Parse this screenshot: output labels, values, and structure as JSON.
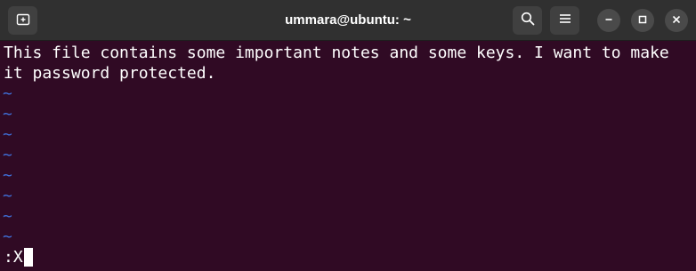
{
  "window": {
    "title": "ummara@ubuntu: ~"
  },
  "icons": {
    "new_tab": "new-tab-icon",
    "search": "search-icon",
    "menu": "hamburger-menu-icon",
    "minimize": "minimize-icon",
    "maximize": "maximize-icon",
    "close": "close-icon"
  },
  "colors": {
    "terminal_background": "#300a24",
    "titlebar": "#303030",
    "text": "#ffffff",
    "tilde": "#3f6fd8"
  },
  "editor": {
    "lines": [
      "This file contains some important notes and some keys. I want to make",
      "it password protected."
    ],
    "empty_line_marker": "~",
    "command_line": ":X"
  }
}
